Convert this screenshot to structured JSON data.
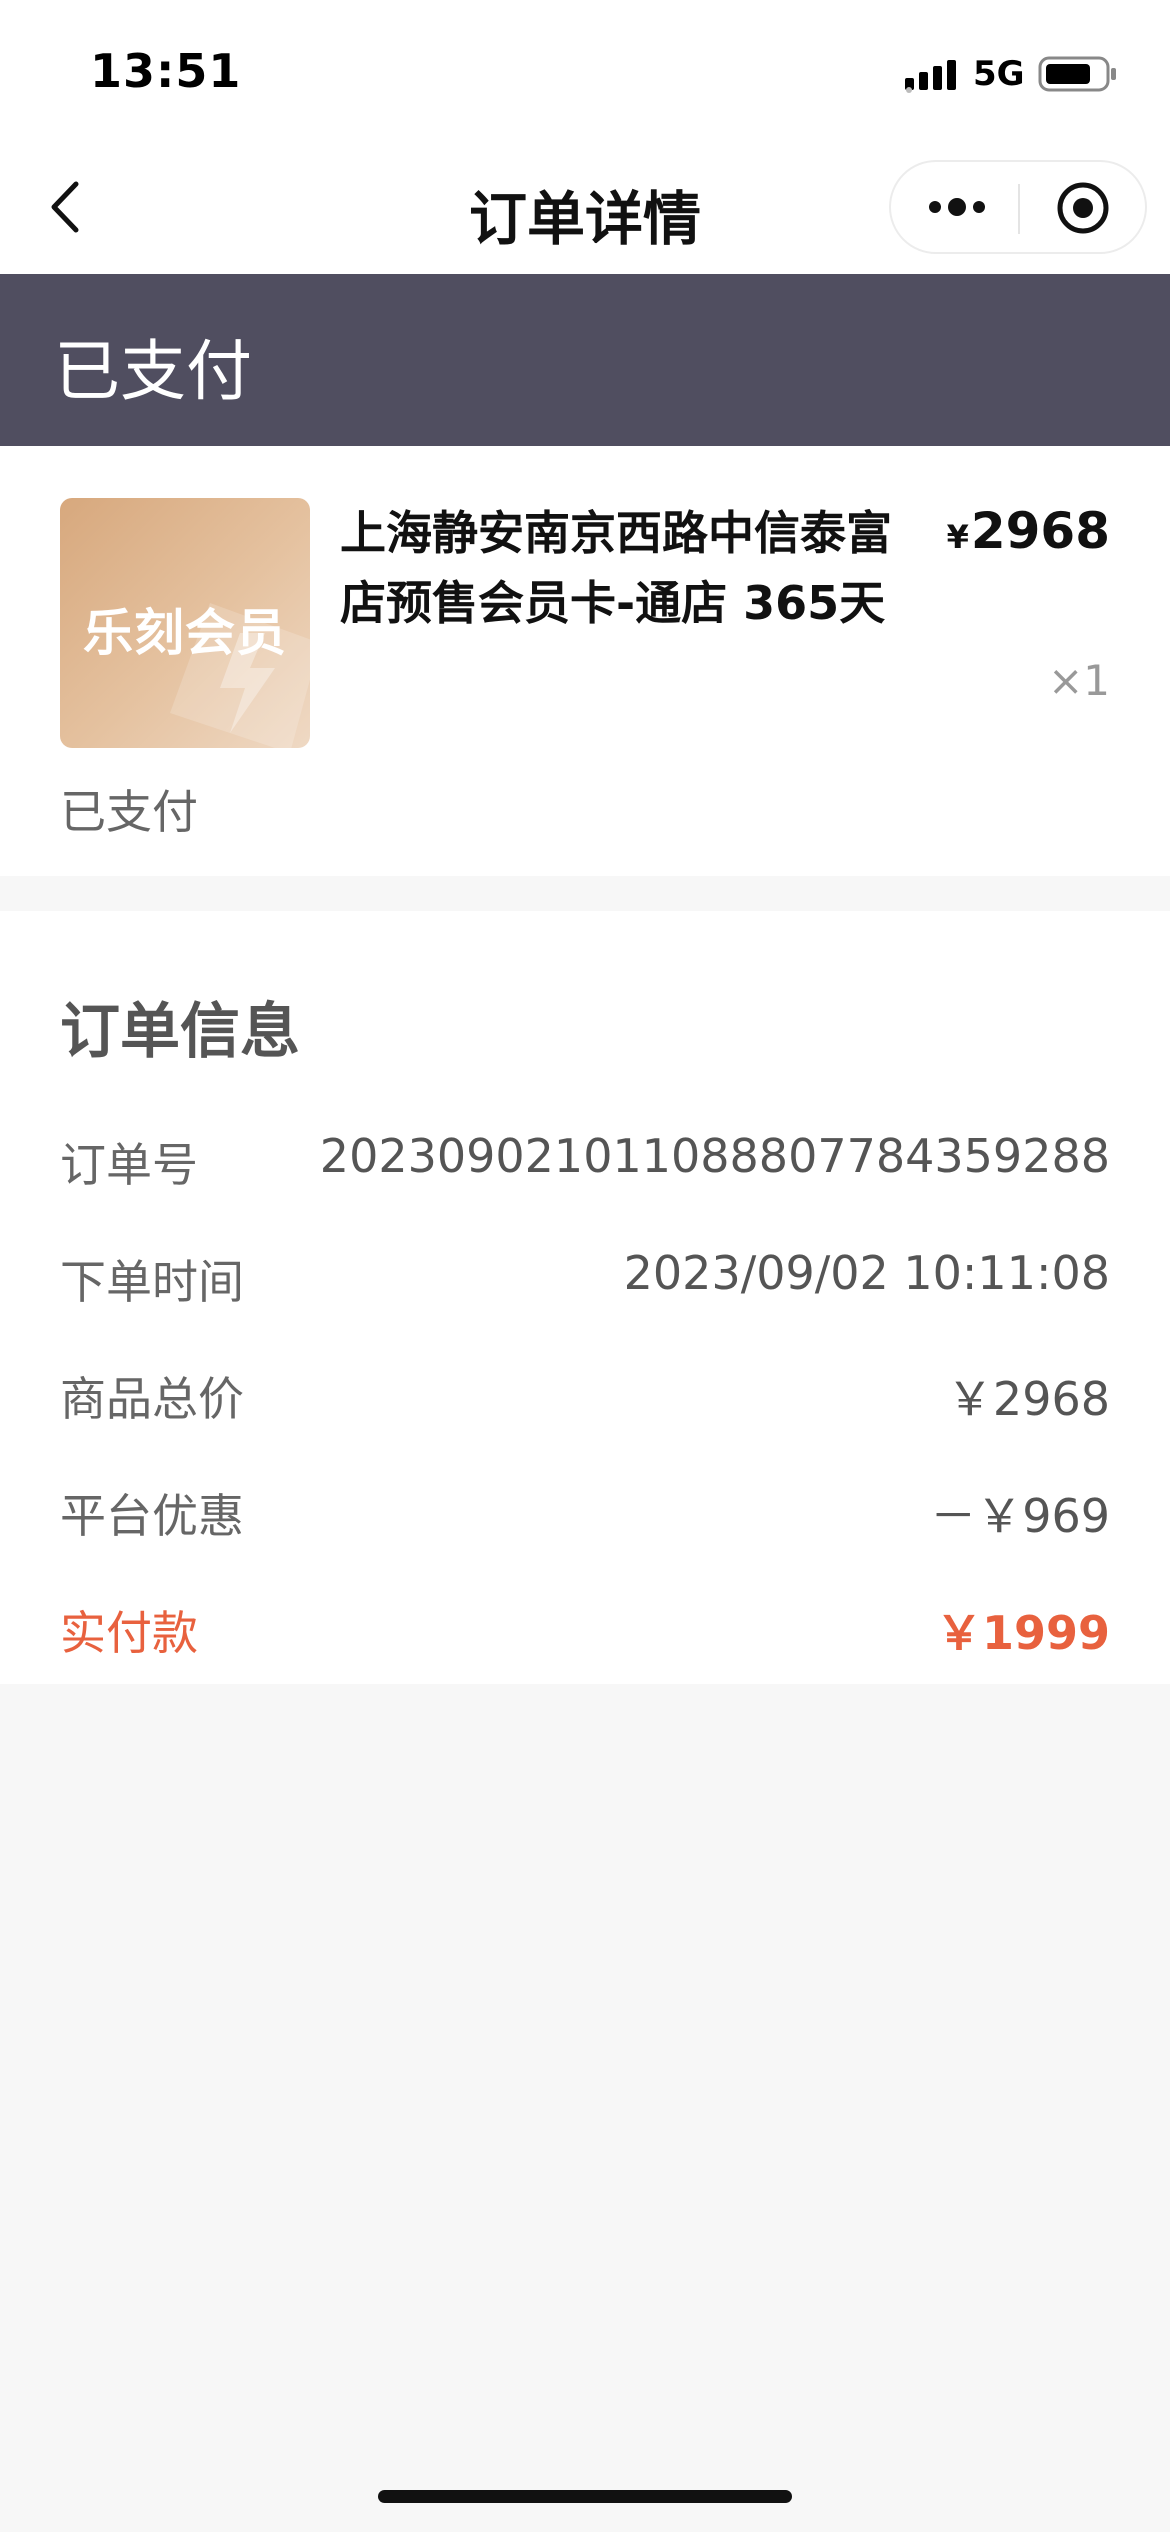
{
  "status_bar": {
    "time": "13:51",
    "network": "5G",
    "signal_icon": "signal-bars-icon",
    "battery_icon": "battery-icon"
  },
  "nav": {
    "title": "订单详情",
    "back_icon": "chevron-left-icon",
    "more_icon": "more-dots-icon",
    "close_icon": "target-circle-icon"
  },
  "banner": {
    "status": "已支付",
    "color": "#504e60"
  },
  "product": {
    "thumbnail_text": "乐刻会员",
    "name": "上海静安南京西路中信泰富店预售会员卡-通店 365天",
    "currency": "¥",
    "price": "2968",
    "quantity": "×1",
    "status": "已支付"
  },
  "order_info": {
    "title": "订单信息",
    "rows": [
      {
        "label": "订单号",
        "value": "20230902101108880778435928​8"
      },
      {
        "label": "下单时间",
        "value": "2023/09/02 10:11:08"
      },
      {
        "label": "商品总价",
        "value": "￥2968"
      },
      {
        "label": "平台优惠",
        "value": "－￥969"
      },
      {
        "label": "实付款",
        "value": "￥1999"
      }
    ],
    "accent_color": "#e8613e"
  }
}
